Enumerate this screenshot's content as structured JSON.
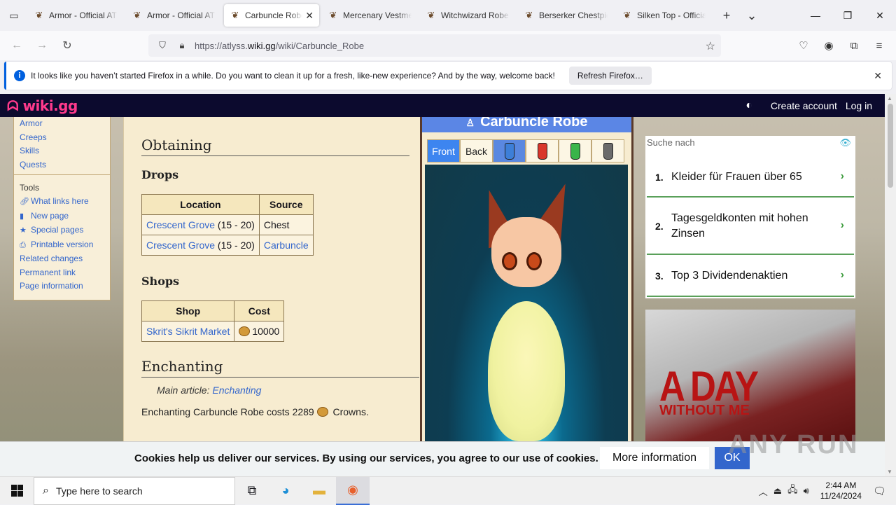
{
  "browser": {
    "tabs": [
      {
        "title": "Armor - Official ATLYSS Wiki",
        "active": false
      },
      {
        "title": "Armor - Official ATLYSS Wiki",
        "active": false
      },
      {
        "title": "Carbuncle Robe",
        "active": true
      },
      {
        "title": "Mercenary Vestment",
        "active": false
      },
      {
        "title": "Witchwizard Robe",
        "active": false
      },
      {
        "title": "Berserker Chestpiece",
        "active": false
      },
      {
        "title": "Silken Top - Official",
        "active": false
      }
    ],
    "url_prefix": "https://atlyss.",
    "url_domain": "wiki.gg",
    "url_path": "/wiki/Carbuncle_Robe",
    "notification": {
      "message": "It looks like you haven’t started Firefox in a while. Do you want to clean it up for a fresh, like-new experience? And by the way, welcome back!",
      "button": "Refresh Firefox…"
    }
  },
  "wiki": {
    "logo": "wiki.gg",
    "create_account": "Create account",
    "login": "Log in",
    "sidebar": {
      "top_links": [
        "Armor",
        "Creeps",
        "Skills",
        "Quests"
      ],
      "tools_heading": "Tools",
      "tools": [
        {
          "label": "What links here",
          "icon": "link-icon"
        },
        {
          "label": "New page",
          "icon": "page-icon"
        },
        {
          "label": "Special pages",
          "icon": "star-icon"
        },
        {
          "label": "Printable version",
          "icon": "printer-icon"
        },
        {
          "label": "Related changes",
          "icon": ""
        },
        {
          "label": "Permanent link",
          "icon": ""
        },
        {
          "label": "Page information",
          "icon": ""
        }
      ]
    },
    "content": {
      "obtaining": "Obtaining",
      "drops": "Drops",
      "drops_headers": [
        "Location",
        "Source"
      ],
      "drops_rows": [
        {
          "location_link": "Crescent Grove",
          "range": " (15 - 20)",
          "source": "Chest",
          "source_link": false
        },
        {
          "location_link": "Crescent Grove",
          "range": " (15 - 20)",
          "source": "Carbuncle",
          "source_link": true
        }
      ],
      "shops": "Shops",
      "shops_headers": [
        "Shop",
        "Cost"
      ],
      "shops_rows": [
        {
          "shop": "Skrit's Sikrit Market",
          "cost": "10000"
        }
      ],
      "enchanting": "Enchanting",
      "main_article_prefix": "Main article: ",
      "main_article_link": "Enchanting",
      "ench_text_before": "Enchanting Carbuncle Robe costs 2289 ",
      "ench_text_after": " Crowns."
    },
    "infobox": {
      "title": "Carbuncle Robe",
      "tabs": [
        "Front",
        "Back"
      ],
      "dye_colors": [
        "#3d7fd8",
        "#d9362b",
        "#39b54a",
        "#6b6b6b"
      ]
    }
  },
  "ads": {
    "label": "Suche nach",
    "items": [
      {
        "num": "1.",
        "text": "Kleider für Frauen über 65"
      },
      {
        "num": "2.",
        "text": "Tagesgeldkonten mit hohen Zinsen"
      },
      {
        "num": "3.",
        "text": "Top 3 Dividendenaktien"
      }
    ],
    "banner_title": "A DAY",
    "banner_sub": "WITHOUT ME"
  },
  "cookie": {
    "message": "Cookies help us deliver our services. By using our services, you agree to our use of cookies.",
    "more": "More information",
    "ok": "OK"
  },
  "watermark": "ANY RUN",
  "taskbar": {
    "search_placeholder": "Type here to search",
    "time": "2:44 AM",
    "date": "11/24/2024"
  }
}
